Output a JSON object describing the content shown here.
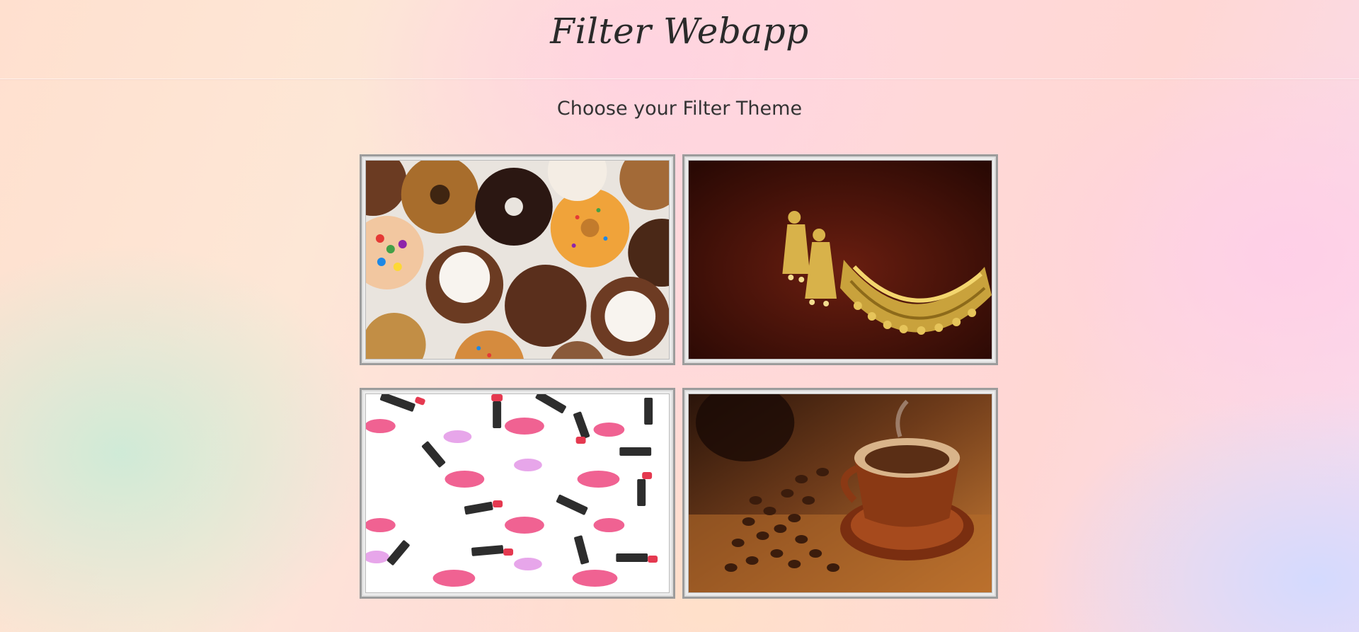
{
  "header": {
    "title": "Filter Webapp"
  },
  "main": {
    "subtitle": "Choose your Filter Theme",
    "themes": [
      {
        "icon": "donuts-image"
      },
      {
        "icon": "jewellery-image"
      },
      {
        "icon": "lipstick-image"
      },
      {
        "icon": "coffee-image"
      }
    ]
  }
}
